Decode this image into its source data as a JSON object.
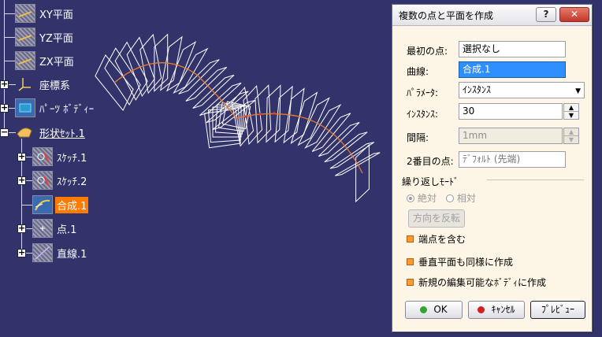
{
  "tree": {
    "items": [
      {
        "label": "XY平面",
        "icon": "plane-icon"
      },
      {
        "label": "YZ平面",
        "icon": "plane-icon"
      },
      {
        "label": "ZX平面",
        "icon": "plane-icon"
      },
      {
        "label": "座標系",
        "icon": "axis-system-icon"
      },
      {
        "label": "ﾊﾟｰﾂ ﾎﾞﾃﾞｨｰ",
        "icon": "part-body-icon"
      },
      {
        "label": "形状ｾｯﾄ.1",
        "icon": "geometrical-set-icon"
      },
      {
        "label": "ｽｹｯﾁ.1",
        "icon": "sketch-icon"
      },
      {
        "label": "ｽｹｯﾁ.2",
        "icon": "sketch-icon"
      },
      {
        "label": "合成.1",
        "icon": "combine-icon"
      },
      {
        "label": "点.1",
        "icon": "point-icon"
      },
      {
        "label": "直線.1",
        "icon": "line-icon"
      }
    ]
  },
  "dialog": {
    "title": "複数の点と平面を作成",
    "help": "?",
    "close": "✕",
    "first_point_label": "最初の点:",
    "first_point_value": "選択なし",
    "curve_label": "曲線:",
    "curve_value": "合成.1",
    "parameter_label": "ﾊﾟﾗﾒｰﾀ:",
    "parameter_value": "ｲﾝｽﾀﾝｽ",
    "instances_label": "ｲﾝｽﾀﾝｽ:",
    "instances_value": "30",
    "spacing_label": "間隔:",
    "spacing_value": "1mm",
    "second_point_label": "2番目の点:",
    "second_point_value": "ﾃﾞﾌｫﾙﾄ (先端)",
    "repeat_mode_label": "繰り返しﾓｰﾄﾞ",
    "absolute_label": "絶対",
    "relative_label": "相対",
    "reverse_direction": "方向を反転",
    "include_ends": "端点を含む",
    "create_normal_planes": "垂直平面も同様に作成",
    "create_in_new_body": "新規の編集可能なﾎﾞﾃﾞｨに作成",
    "ok": "OK",
    "cancel": "ｷｬﾝｾﾙ",
    "preview": "ﾌﾟﾚﾋﾞｭｰ"
  },
  "colors": {
    "background": "#33336b",
    "selected": "#ff7a00",
    "curve": "#e87a30",
    "planes": "#ffffff",
    "field_highlight": "#2f8fff"
  }
}
